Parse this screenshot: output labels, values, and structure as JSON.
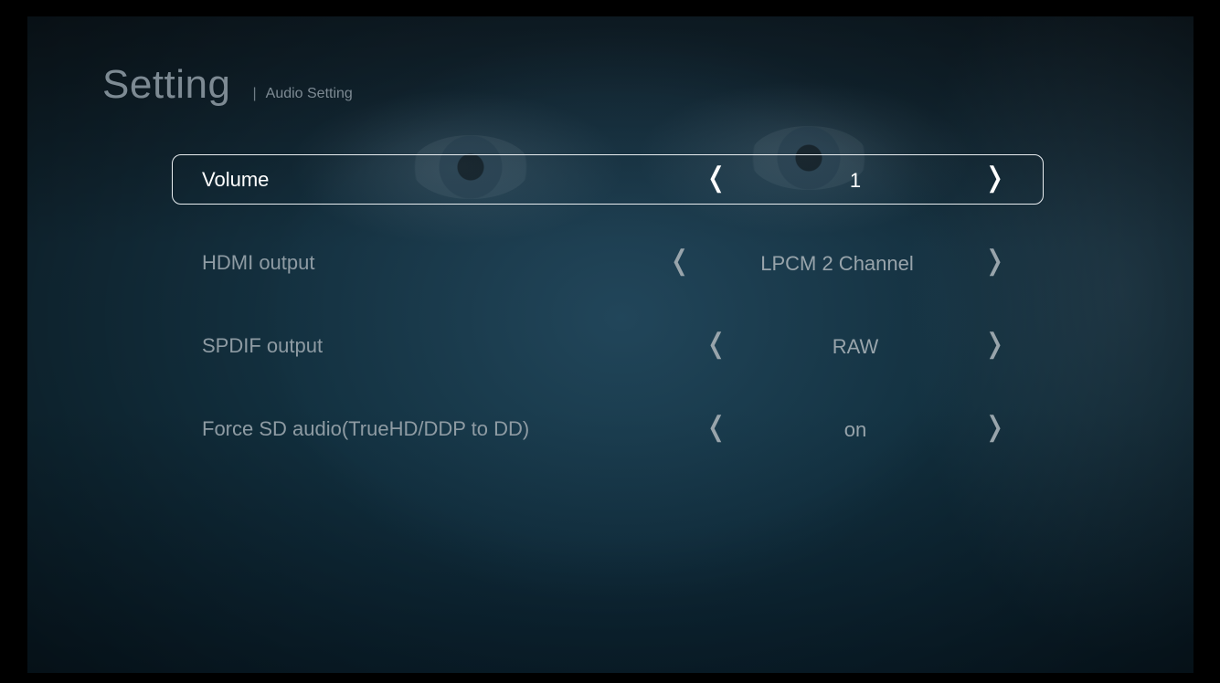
{
  "header": {
    "title": "Setting",
    "separator": "|",
    "subtitle": "Audio Setting"
  },
  "settings": [
    {
      "label": "Volume",
      "value": "1",
      "selected": true
    },
    {
      "label": "HDMI output",
      "value": "LPCM 2 Channel",
      "selected": false
    },
    {
      "label": "SPDIF output",
      "value": "RAW",
      "selected": false
    },
    {
      "label": "Force SD audio(TrueHD/DDP to DD)",
      "value": "on",
      "selected": false
    }
  ],
  "icons": {
    "prev": "chevron-left-icon",
    "next": "chevron-right-icon"
  },
  "colors": {
    "highlight_border": "#e9eef1",
    "text_normal": "#8e9ba3",
    "text_selected": "#ffffff"
  }
}
